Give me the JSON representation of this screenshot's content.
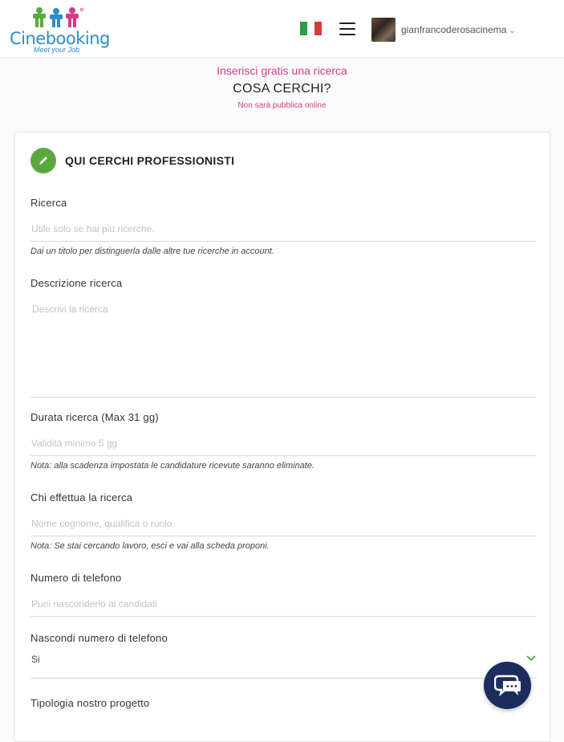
{
  "header": {
    "logo_text": "Cinebooking",
    "logo_tagline": "Meet your Job",
    "language_flag": "it-flag",
    "menu_icon": "hamburger-icon",
    "user": {
      "name": "gianfrancoderosacinema",
      "chevron": "⌄"
    }
  },
  "colors": {
    "accent_pink": "#d63d83",
    "brand_blue": "#2a8fc2",
    "green_icon": "#5ba83e",
    "chat_navy": "#1d2c5e",
    "flag": [
      "#2e9a4a",
      "#ffffff",
      "#d83a3a"
    ]
  },
  "intro": {
    "line1": "Inserisci gratis una ricerca",
    "title": "COSA CERCHI?",
    "note": "Non sarà pubblica online"
  },
  "form": {
    "section_icon": "pencil-icon",
    "section_title": "QUI CERCHI PROFESSIONISTI",
    "ricerca": {
      "label": "Ricerca",
      "placeholder": "Utile solo se hai più ricerche.",
      "hint": "Dai un titolo per distinguerla dalle altre tue ricerche in account."
    },
    "descrizione": {
      "label": "Descrizione ricerca",
      "placeholder": "Descrivi la ricerca"
    },
    "durata": {
      "label": "Durata ricerca (Max 31 gg)",
      "placeholder": "Validità minimo 5 gg",
      "hint": "Nota: alla scadenza impostata le candidature ricevute saranno eliminate."
    },
    "chi": {
      "label": "Chi effettua la ricerca",
      "placeholder": "Nome cognome, qualifica o ruolo",
      "hint": "Nota: Se stai cercando lavoro, esci e vai alla scheda proponi."
    },
    "telefono": {
      "label": "Numero di telefono",
      "placeholder": "Puoi nasconderlo ai candidati"
    },
    "nascondi": {
      "label": "Nascondi numero di telefono",
      "value": "Si"
    },
    "tipologia": {
      "label": "Tipologia nostro progetto"
    }
  },
  "chat": {
    "icon": "chat-bubble-icon"
  }
}
